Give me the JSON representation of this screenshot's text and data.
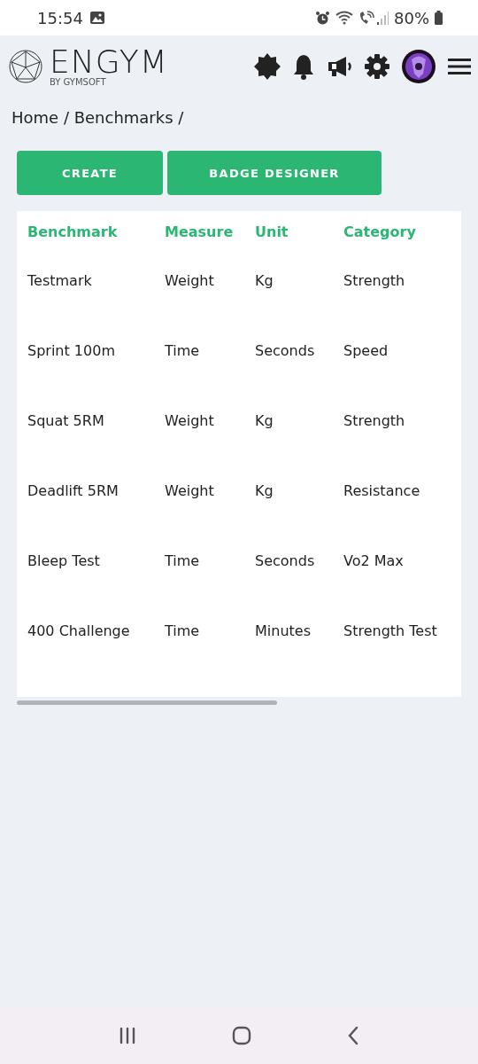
{
  "status_bar": {
    "time": "15:54",
    "battery": "80%"
  },
  "header": {
    "logo": "ENGYM",
    "tagline": "BY GYMSOFT"
  },
  "breadcrumb": "Home / Benchmarks /",
  "buttons": [
    "CREATE",
    "BADGE DESIGNER"
  ],
  "table": {
    "columns": [
      "Benchmark",
      "Measure",
      "Unit",
      "Category"
    ],
    "rows": [
      [
        "Testmark",
        "Weight",
        "Kg",
        "Strength"
      ],
      [
        "Sprint 100m",
        "Time",
        "Seconds",
        "Speed"
      ],
      [
        "Squat 5RM",
        "Weight",
        "Kg",
        "Strength"
      ],
      [
        "Deadlift 5RM",
        "Weight",
        "Kg",
        "Resistance"
      ],
      [
        "Bleep Test",
        "Time",
        "Seconds",
        "Vo2 Max"
      ],
      [
        "400 Challenge",
        "Time",
        "Minutes",
        "Strength Test"
      ]
    ]
  }
}
